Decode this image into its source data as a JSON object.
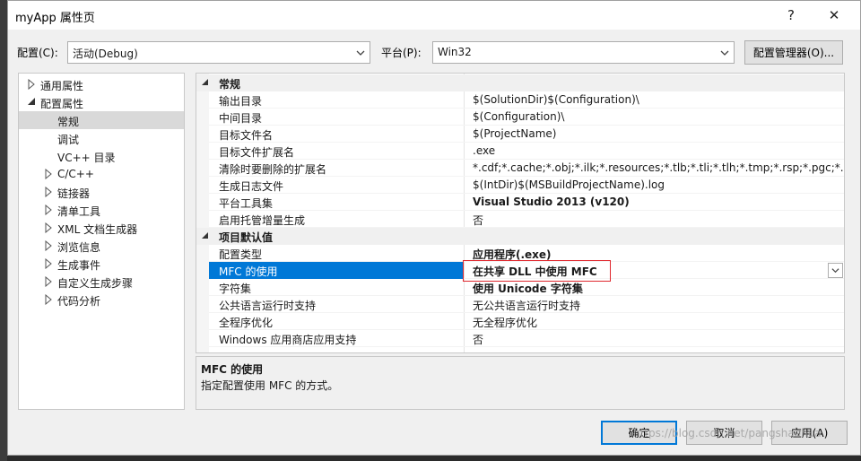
{
  "window": {
    "title": "myApp 属性页",
    "help_glyph": "?",
    "close_glyph": "✕"
  },
  "toolbar": {
    "config_label": "配置(C):",
    "config_value": "活动(Debug)",
    "platform_label": "平台(P):",
    "platform_value": "Win32",
    "config_manager_label": "配置管理器(O)..."
  },
  "tree": {
    "items": [
      {
        "label": "通用属性"
      },
      {
        "label": "配置属性"
      },
      {
        "label": "常规"
      },
      {
        "label": "调试"
      },
      {
        "label": "VC++ 目录"
      },
      {
        "label": "C/C++"
      },
      {
        "label": "链接器"
      },
      {
        "label": "清单工具"
      },
      {
        "label": "XML 文档生成器"
      },
      {
        "label": "浏览信息"
      },
      {
        "label": "生成事件"
      },
      {
        "label": "自定义生成步骤"
      },
      {
        "label": "代码分析"
      }
    ]
  },
  "grid": {
    "categories": [
      {
        "label": "常规"
      },
      {
        "label": "项目默认值"
      }
    ],
    "general_rows": [
      {
        "name": "输出目录",
        "value": "$(SolutionDir)$(Configuration)\\"
      },
      {
        "name": "中间目录",
        "value": "$(Configuration)\\"
      },
      {
        "name": "目标文件名",
        "value": "$(ProjectName)"
      },
      {
        "name": "目标文件扩展名",
        "value": ".exe"
      },
      {
        "name": "清除时要删除的扩展名",
        "value": "*.cdf;*.cache;*.obj;*.ilk;*.resources;*.tlb;*.tli;*.tlh;*.tmp;*.rsp;*.pgc;*.pgd;*.m"
      },
      {
        "name": "生成日志文件",
        "value": "$(IntDir)$(MSBuildProjectName).log"
      },
      {
        "name": "平台工具集",
        "value": "Visual Studio 2013 (v120)"
      },
      {
        "name": "启用托管增量生成",
        "value": "否"
      }
    ],
    "default_rows": [
      {
        "name": "配置类型",
        "value": "应用程序(.exe)"
      },
      {
        "name": "MFC 的使用",
        "value": "在共享 DLL 中使用 MFC"
      },
      {
        "name": "字符集",
        "value": "使用 Unicode 字符集"
      },
      {
        "name": "公共语言运行时支持",
        "value": "无公共语言运行时支持"
      },
      {
        "name": "全程序优化",
        "value": "无全程序优化"
      },
      {
        "name": "Windows 应用商店应用支持",
        "value": "否"
      }
    ]
  },
  "description": {
    "heading": "MFC 的使用",
    "text": "指定配置使用 MFC 的方式。"
  },
  "buttons": {
    "ok": "确定",
    "cancel": "取消",
    "apply": "应用(A)"
  },
  "watermark": "https://blog.csdn.net/pangshaohua",
  "colors": {
    "selection": "#0078d7",
    "tree_selection": "#cce8ff",
    "highlight_box": "#e0282e"
  }
}
